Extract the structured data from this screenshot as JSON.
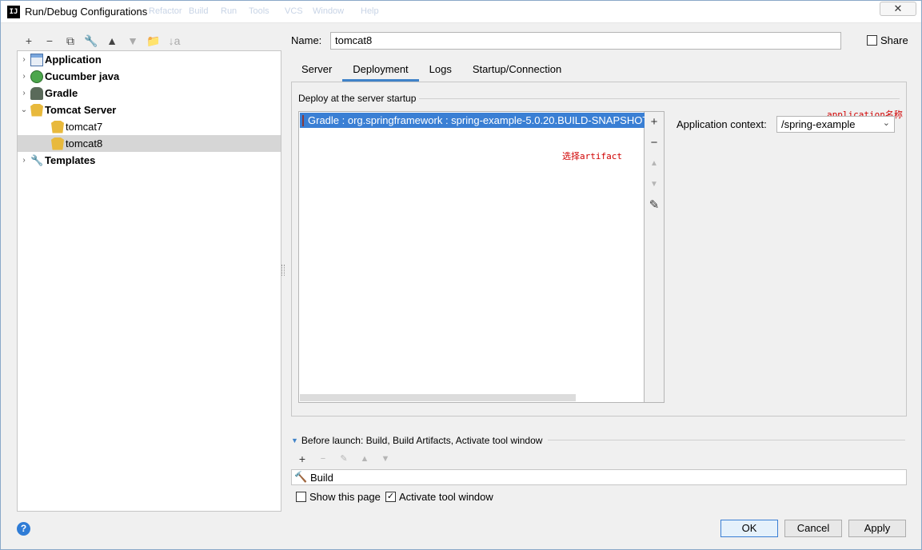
{
  "window": {
    "title": "Run/Debug Configurations",
    "app_icon": "IJ",
    "ghost_menu": [
      "Refactor",
      "Build",
      "Run",
      "Tools",
      "VCS",
      "Window",
      "Help"
    ],
    "close_label": "✕"
  },
  "left_toolbar": {
    "add": "+",
    "remove": "−",
    "copy": "⧉",
    "edit_defaults": "🔧",
    "move_up": "▲",
    "move_down": "▼",
    "folder": "📁",
    "sort": "↓a"
  },
  "tree": [
    {
      "label": "Application",
      "icon": "application-icon",
      "bold": true,
      "expand": "›"
    },
    {
      "label": "Cucumber java",
      "icon": "cucumber-icon",
      "bold": true,
      "expand": "›"
    },
    {
      "label": "Gradle",
      "icon": "gradle-icon",
      "bold": true,
      "expand": "›"
    },
    {
      "label": "Tomcat Server",
      "icon": "tomcat-icon",
      "bold": true,
      "expand": "⌄"
    },
    {
      "label": "tomcat7",
      "icon": "tomcat-icon",
      "bold": false
    },
    {
      "label": "tomcat8",
      "icon": "tomcat-icon",
      "bold": false,
      "selected": true
    },
    {
      "label": "Templates",
      "icon": "wrench-icon",
      "bold": true,
      "expand": "›"
    }
  ],
  "form": {
    "name_label": "Name:",
    "name_value": "tomcat8",
    "share_label": "Share",
    "tabs": [
      "Server",
      "Deployment",
      "Logs",
      "Startup/Connection"
    ],
    "active_tab": "Deployment"
  },
  "deployment": {
    "section_title": "Deploy at the server startup",
    "items": [
      "Gradle : org.springframework : spring-example-5.0.20.BUILD-SNAPSHOT"
    ],
    "side_buttons": {
      "add": "+",
      "remove": "−",
      "up": "▲",
      "down": "▼",
      "edit": "✎"
    },
    "context_label": "Application context:",
    "context_value": "/spring-example"
  },
  "annotations": {
    "artifact": "选择artifact",
    "app_name": "application名称"
  },
  "before_launch": {
    "title": "Before launch: Build, Build Artifacts, Activate tool window",
    "toolbar": {
      "add": "+",
      "remove": "−",
      "edit": "✎",
      "up": "▲",
      "down": "▼"
    },
    "tasks": [
      "Build"
    ],
    "show_page_label": "Show this page",
    "show_page_checked": false,
    "activate_label": "Activate tool window",
    "activate_checked": true
  },
  "footer": {
    "help": "?",
    "ok": "OK",
    "cancel": "Cancel",
    "apply": "Apply"
  },
  "colors": {
    "selection": "#3a7fd4",
    "tab_underline": "#4083c9",
    "annotation": "#d00000"
  }
}
